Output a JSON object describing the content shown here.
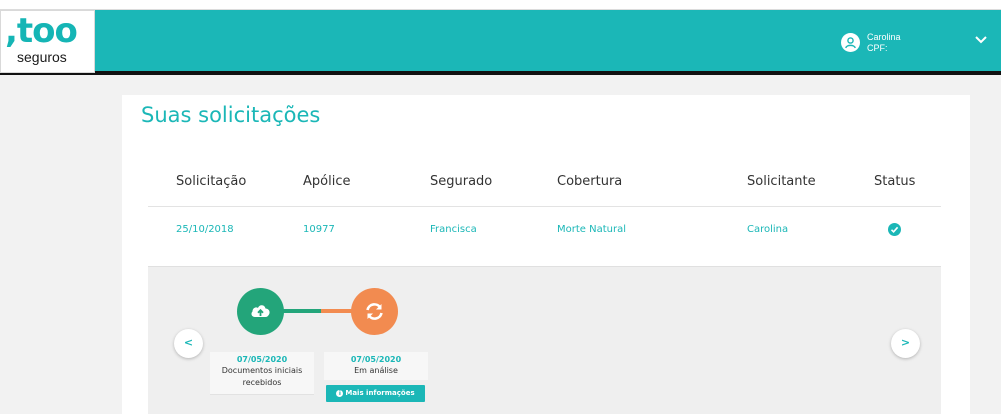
{
  "brand": {
    "logo_main": ",too",
    "logo_sub": "seguros"
  },
  "user": {
    "name": "Carolina",
    "cpf_label": "CPF:"
  },
  "page": {
    "title": "Suas solicitações"
  },
  "table": {
    "columns": [
      "Solicitação",
      "Apólice",
      "Segurado",
      "Cobertura",
      "Solicitante",
      "Status"
    ],
    "rows": [
      {
        "solicitacao": "25/10/2018",
        "apolice": "10977",
        "segurado": "Francisca",
        "cobertura": "Morte Natural",
        "solicitante": "Carolina",
        "status_icon": "check-circle-icon"
      }
    ]
  },
  "timeline": {
    "prev_label": "<",
    "next_label": ">",
    "steps": [
      {
        "date": "07/05/2020",
        "label_line1": "Documentos iniciais",
        "label_line2": "recebidos",
        "icon": "cloud-upload-icon",
        "color": "#23a57a"
      },
      {
        "date": "07/05/2020",
        "label_line1": "Em análise",
        "icon": "refresh-icon",
        "color": "#f28b50"
      }
    ],
    "more_info_label": "Mais informações"
  },
  "colors": {
    "brand": "#1bb7b7",
    "done": "#23a57a",
    "in_progress": "#f28b50"
  }
}
